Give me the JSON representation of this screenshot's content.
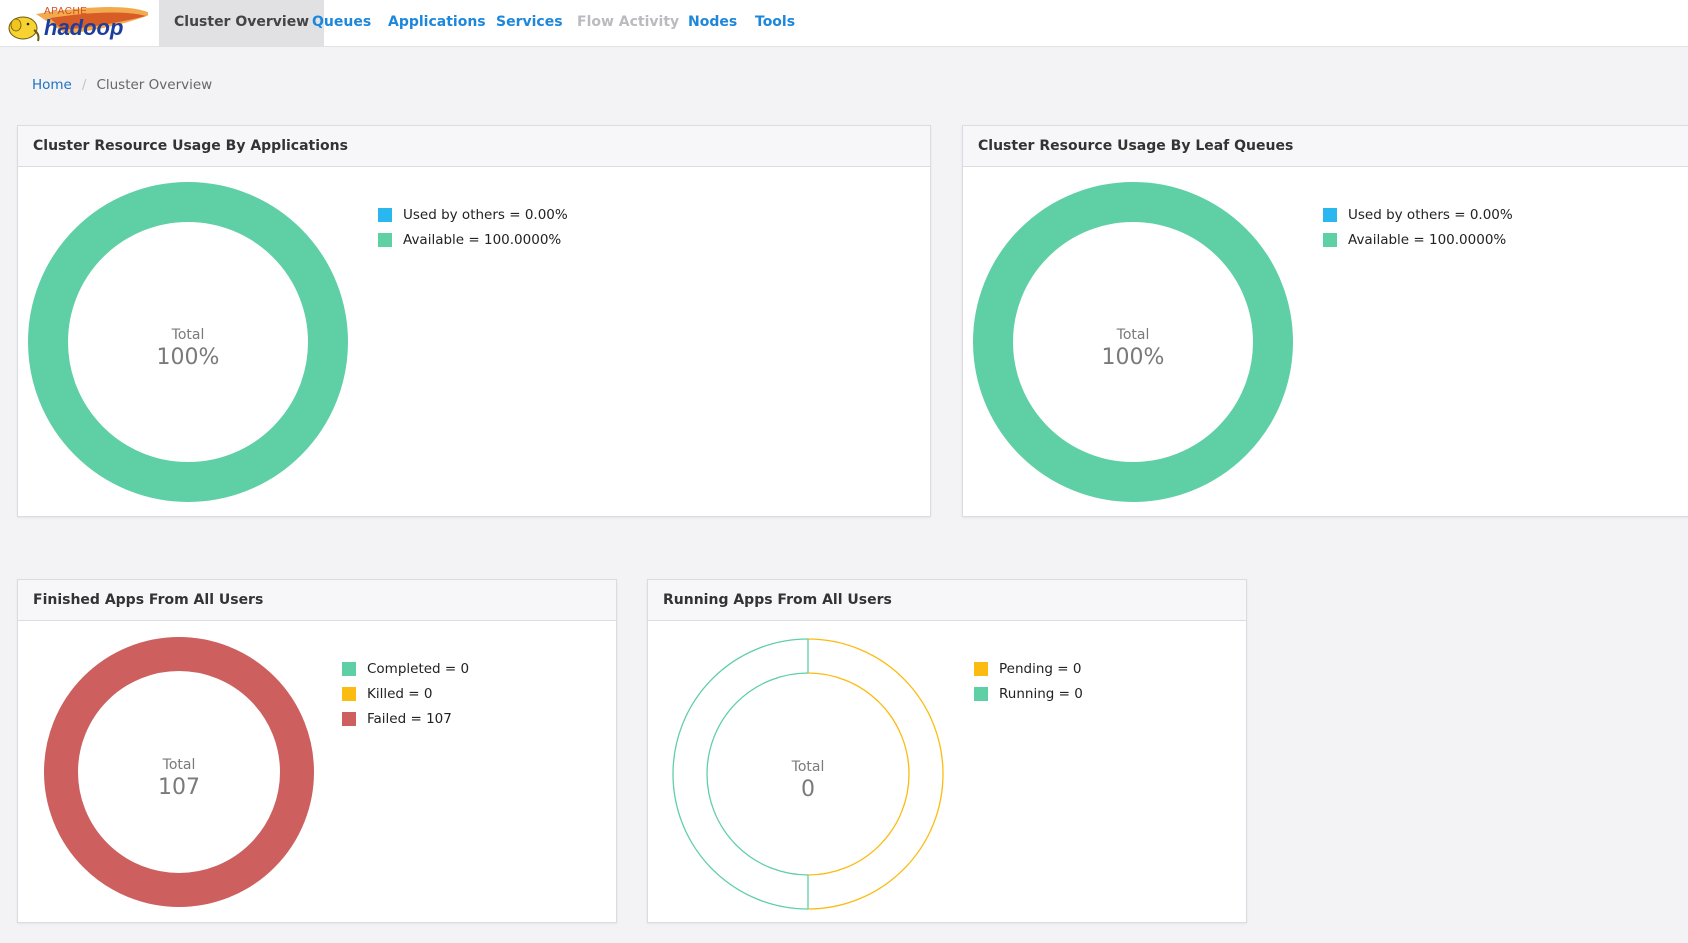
{
  "logo": {
    "apache": "APACHE",
    "word": "hadoop"
  },
  "nav": {
    "items": [
      {
        "label": "Cluster Overview",
        "state": "active"
      },
      {
        "label": "Queues",
        "state": "normal"
      },
      {
        "label": "Applications",
        "state": "normal"
      },
      {
        "label": "Services",
        "state": "normal"
      },
      {
        "label": "Flow Activity",
        "state": "disabled"
      },
      {
        "label": "Nodes",
        "state": "normal"
      },
      {
        "label": "Tools",
        "state": "normal"
      }
    ]
  },
  "breadcrumb": {
    "home": "Home",
    "separator": "/",
    "current": "Cluster Overview"
  },
  "colors": {
    "blue": "#2ab7ef",
    "green": "#5fcfa5",
    "amber": "#fbbb10",
    "red": "#cd5f5f"
  },
  "panels": {
    "by_apps": {
      "title": "Cluster Resource Usage By Applications",
      "center_label": "Total",
      "center_value": "100%",
      "legend": [
        {
          "label": "Used by others = 0.00%",
          "color": "#2ab7ef"
        },
        {
          "label": "Available = 100.0000%",
          "color": "#5fcfa5"
        }
      ]
    },
    "by_queues": {
      "title": "Cluster Resource Usage By Leaf Queues",
      "center_label": "Total",
      "center_value": "100%",
      "legend": [
        {
          "label": "Used by others = 0.00%",
          "color": "#2ab7ef"
        },
        {
          "label": "Available = 100.0000%",
          "color": "#5fcfa5"
        }
      ]
    },
    "finished": {
      "title": "Finished Apps From All Users",
      "center_label": "Total",
      "center_value": "107",
      "legend": [
        {
          "label": "Completed = 0",
          "color": "#5fcfa5"
        },
        {
          "label": "Killed = 0",
          "color": "#fbbb10"
        },
        {
          "label": "Failed = 107",
          "color": "#cd5f5f"
        }
      ]
    },
    "running": {
      "title": "Running Apps From All Users",
      "center_label": "Total",
      "center_value": "0",
      "legend": [
        {
          "label": "Pending = 0",
          "color": "#fbbb10"
        },
        {
          "label": "Running = 0",
          "color": "#5fcfa5"
        }
      ]
    }
  },
  "chart_data": [
    {
      "type": "pie",
      "title": "Cluster Resource Usage By Applications",
      "categories": [
        "Used by others",
        "Available"
      ],
      "values": [
        0.0,
        100.0
      ]
    },
    {
      "type": "pie",
      "title": "Cluster Resource Usage By Leaf Queues",
      "categories": [
        "Used by others",
        "Available"
      ],
      "values": [
        0.0,
        100.0
      ]
    },
    {
      "type": "pie",
      "title": "Finished Apps From All Users",
      "categories": [
        "Completed",
        "Killed",
        "Failed"
      ],
      "values": [
        0,
        0,
        107
      ]
    },
    {
      "type": "pie",
      "title": "Running Apps From All Users",
      "categories": [
        "Pending",
        "Running"
      ],
      "values": [
        0,
        0
      ]
    }
  ]
}
